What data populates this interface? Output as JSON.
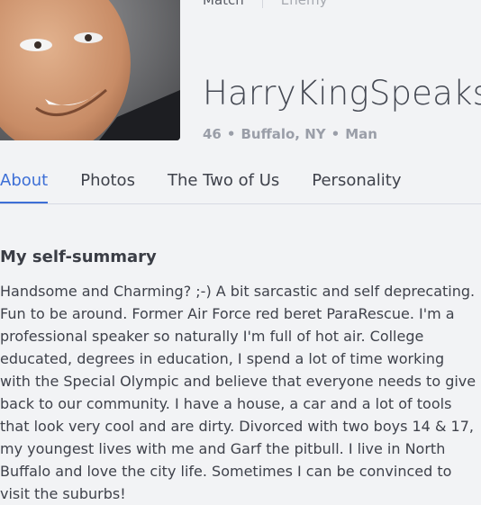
{
  "header": {
    "match_label": "Match",
    "enemy_label": "Enemy",
    "username": "HarryKingSpeaks",
    "age": "46",
    "location": "Buffalo, NY",
    "gender": "Man",
    "separator": "•"
  },
  "tabs": [
    {
      "label": "About",
      "active": true
    },
    {
      "label": "Photos",
      "active": false
    },
    {
      "label": "The Two of Us",
      "active": false
    },
    {
      "label": "Personality",
      "active": false
    }
  ],
  "about": {
    "title": "My self-summary",
    "text": "Handsome and Charming? ;-) A bit sarcastic and self deprecating. Fun to be around. Former Air Force red beret ParaRescue. I'm a professional speaker so naturally I'm full of hot air. College educated, degrees in education, I spend a lot of time working with the Special Olympic and believe that everyone needs to give back to our community. I have a house, a car and a lot of tools that look very cool and are dirty. Divorced with two boys 14 & 17, my youngest lives with me and Garf the pitbull. I live in North Buffalo and love the city life. Sometimes I can be convinced to visit the suburbs!"
  },
  "colors": {
    "accent": "#3d6fd6",
    "background": "#f2f3f5"
  }
}
